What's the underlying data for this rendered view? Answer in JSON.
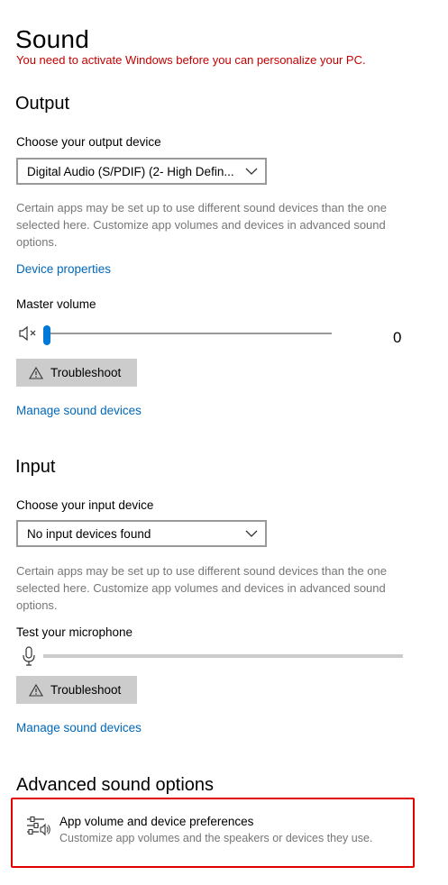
{
  "page": {
    "title": "Sound",
    "warning": "You need to activate Windows before you can personalize your PC."
  },
  "output": {
    "title": "Output",
    "device_label": "Choose your output device",
    "device_value": "Digital Audio (S/PDIF) (2- High Defin...",
    "help": "Certain apps may be set up to use different sound devices than the one selected here. Customize app volumes and devices in advanced sound options.",
    "device_properties_link": "Device properties",
    "master_volume_label": "Master volume",
    "volume_value": "0",
    "volume_level": 0,
    "troubleshoot_label": "Troubleshoot",
    "manage_link": "Manage sound devices"
  },
  "input": {
    "title": "Input",
    "device_label": "Choose your input device",
    "device_value": "No input devices found",
    "help": "Certain apps may be set up to use different sound devices than the one selected here. Customize app volumes and devices in advanced sound options.",
    "test_label": "Test your microphone",
    "mic_level": 0,
    "troubleshoot_label": "Troubleshoot",
    "manage_link": "Manage sound devices"
  },
  "advanced": {
    "title": "Advanced sound options",
    "item_title": "App volume and device preferences",
    "item_subtitle": "Customize app volumes and the speakers or devices they use.",
    "item_icon": "sliders-speaker-icon",
    "highlight_color": "#e00000"
  },
  "colors": {
    "accent": "#0078d7",
    "link": "#0067b8",
    "warning": "#c40000"
  }
}
